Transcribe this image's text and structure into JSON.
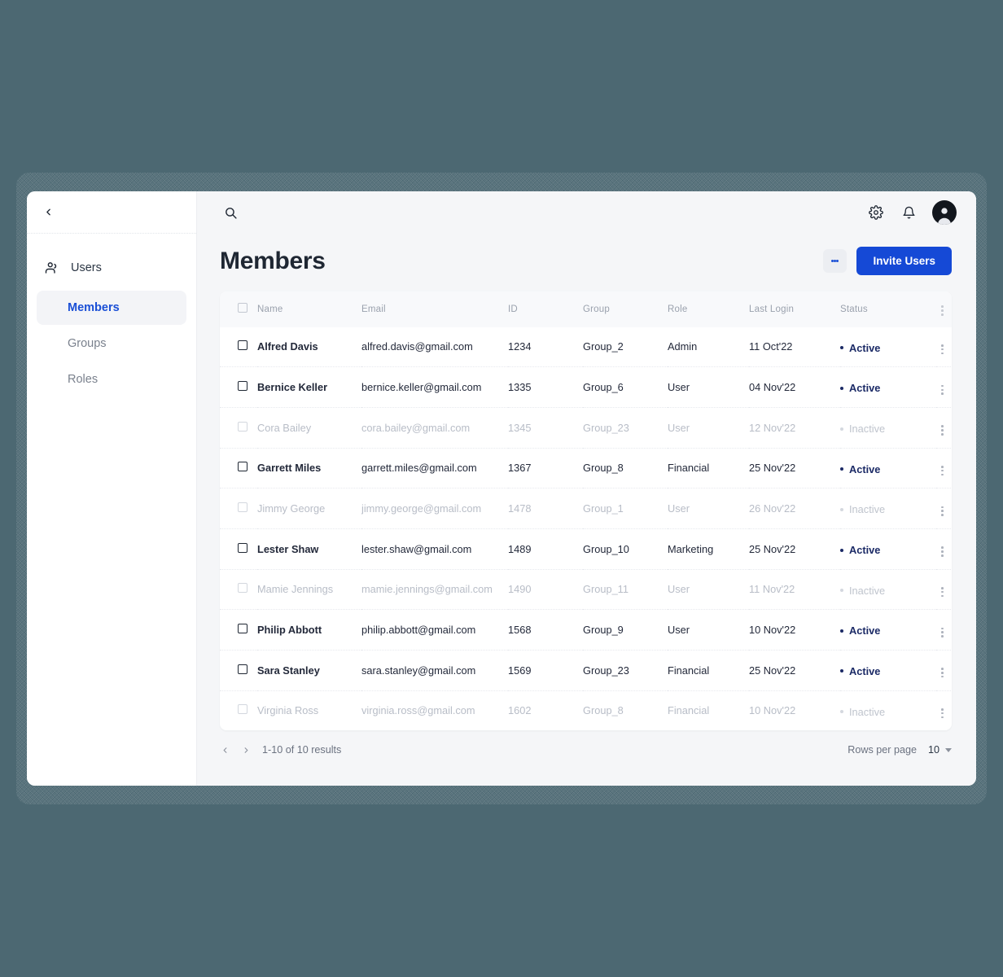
{
  "theme": {
    "desktop_bg": "#4c6872",
    "accent_blue": "#1549d6",
    "status_active_color": "#1b2a66",
    "status_inactive_color": "#bfc4cd"
  },
  "sidebar": {
    "back_icon": "chevron-left-icon",
    "parent": {
      "label": "Users",
      "icon": "users-icon"
    },
    "items": [
      {
        "label": "Members",
        "active": true
      },
      {
        "label": "Groups",
        "active": false
      },
      {
        "label": "Roles",
        "active": false
      }
    ]
  },
  "topbar": {
    "search_icon": "search-icon",
    "settings_icon": "gear-icon",
    "notifications_icon": "bell-icon",
    "avatar_icon": "user-avatar"
  },
  "header": {
    "title": "Members",
    "more_label": "more-options",
    "invite_label": "Invite Users"
  },
  "table": {
    "columns": [
      "Name",
      "Email",
      "ID",
      "Group",
      "Role",
      "Last Login",
      "Status"
    ],
    "rows": [
      {
        "name": "Alfred Davis",
        "email": "alfred.davis@gmail.com",
        "id": "1234",
        "group": "Group_2",
        "role": "Admin",
        "last_login": "11 Oct'22",
        "status": "Active",
        "active": true
      },
      {
        "name": "Bernice Keller",
        "email": "bernice.keller@gmail.com",
        "id": "1335",
        "group": "Group_6",
        "role": "User",
        "last_login": "04 Nov'22",
        "status": "Active",
        "active": true
      },
      {
        "name": "Cora Bailey",
        "email": "cora.bailey@gmail.com",
        "id": "1345",
        "group": "Group_23",
        "role": "User",
        "last_login": "12 Nov'22",
        "status": "Inactive",
        "active": false
      },
      {
        "name": "Garrett Miles",
        "email": "garrett.miles@gmail.com",
        "id": "1367",
        "group": "Group_8",
        "role": "Financial",
        "last_login": "25 Nov'22",
        "status": "Active",
        "active": true
      },
      {
        "name": "Jimmy George",
        "email": "jimmy.george@gmail.com",
        "id": "1478",
        "group": "Group_1",
        "role": "User",
        "last_login": "26 Nov'22",
        "status": "Inactive",
        "active": false
      },
      {
        "name": "Lester Shaw",
        "email": "lester.shaw@gmail.com",
        "id": "1489",
        "group": "Group_10",
        "role": "Marketing",
        "last_login": "25 Nov'22",
        "status": "Active",
        "active": true
      },
      {
        "name": "Mamie Jennings",
        "email": "mamie.jennings@gmail.com",
        "id": "1490",
        "group": "Group_11",
        "role": "User",
        "last_login": "11 Nov'22",
        "status": "Inactive",
        "active": false
      },
      {
        "name": "Philip Abbott",
        "email": "philip.abbott@gmail.com",
        "id": "1568",
        "group": "Group_9",
        "role": "User",
        "last_login": "10 Nov'22",
        "status": "Active",
        "active": true
      },
      {
        "name": "Sara Stanley",
        "email": "sara.stanley@gmail.com",
        "id": "1569",
        "group": "Group_23",
        "role": "Financial",
        "last_login": "25 Nov'22",
        "status": "Active",
        "active": true
      },
      {
        "name": "Virginia Ross",
        "email": "virginia.ross@gmail.com",
        "id": "1602",
        "group": "Group_8",
        "role": "Financial",
        "last_login": "10 Nov'22",
        "status": "Inactive",
        "active": false
      }
    ]
  },
  "pagination": {
    "results_text": "1-10 of 10 results",
    "rows_per_page_label": "Rows per page",
    "rows_per_page_value": "10"
  }
}
